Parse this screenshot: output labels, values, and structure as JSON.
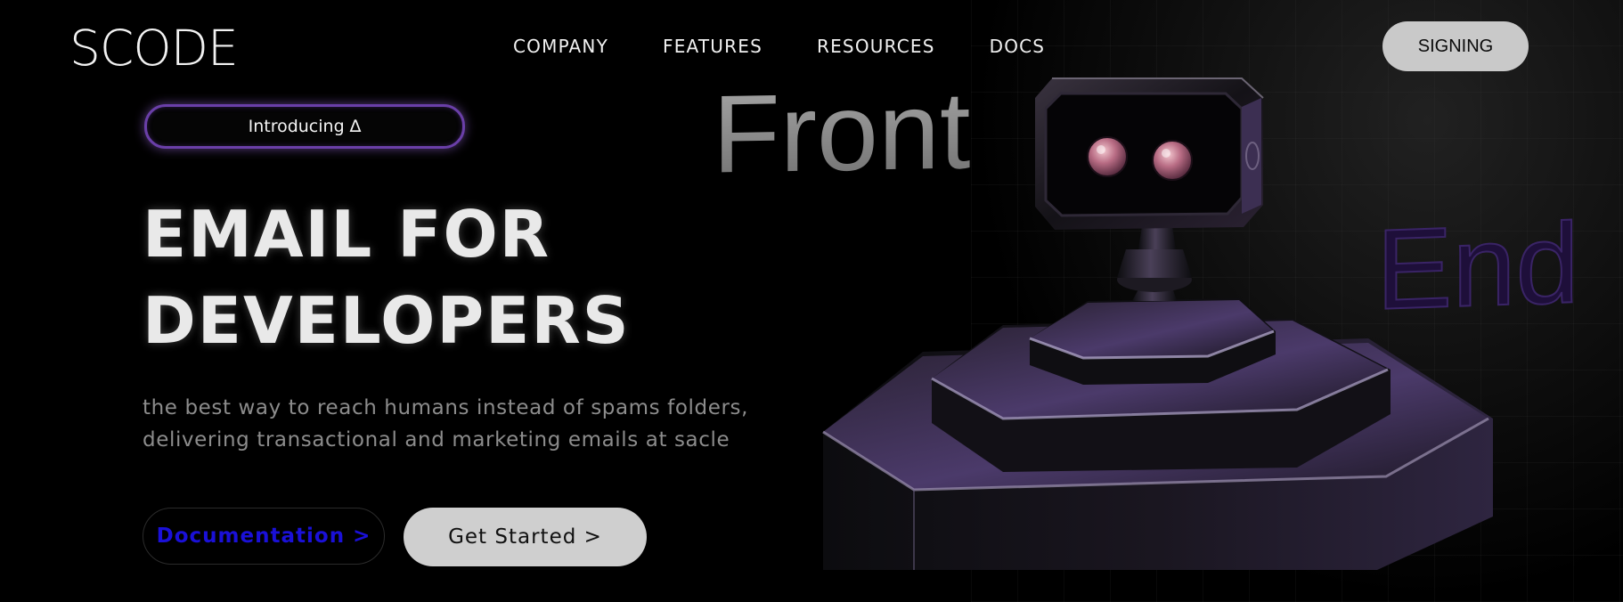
{
  "header": {
    "logo": "SCODE",
    "nav": [
      "COMPANY",
      "FEATURES",
      "RESOURCES",
      "DOCS"
    ],
    "signin_label": "SIGNING"
  },
  "hero": {
    "badge": "Introducing ∆",
    "title_line1": "EMAIL FOR",
    "title_line2": "DEVELOPERS",
    "subtitle_line1": "the best way to reach humans instead of spams folders,",
    "subtitle_line2": "delivering transactional and marketing emails at sacle",
    "docs_button": "Documentation >",
    "start_button": "Get Started >"
  },
  "illustration": {
    "word_left": "Front",
    "word_right": "End",
    "icon": "robot-icon"
  },
  "colors": {
    "background": "#000000",
    "accent_purple": "#6a3fa8",
    "docs_link": "#1a10d8",
    "button_gray": "#cfcfcf"
  }
}
